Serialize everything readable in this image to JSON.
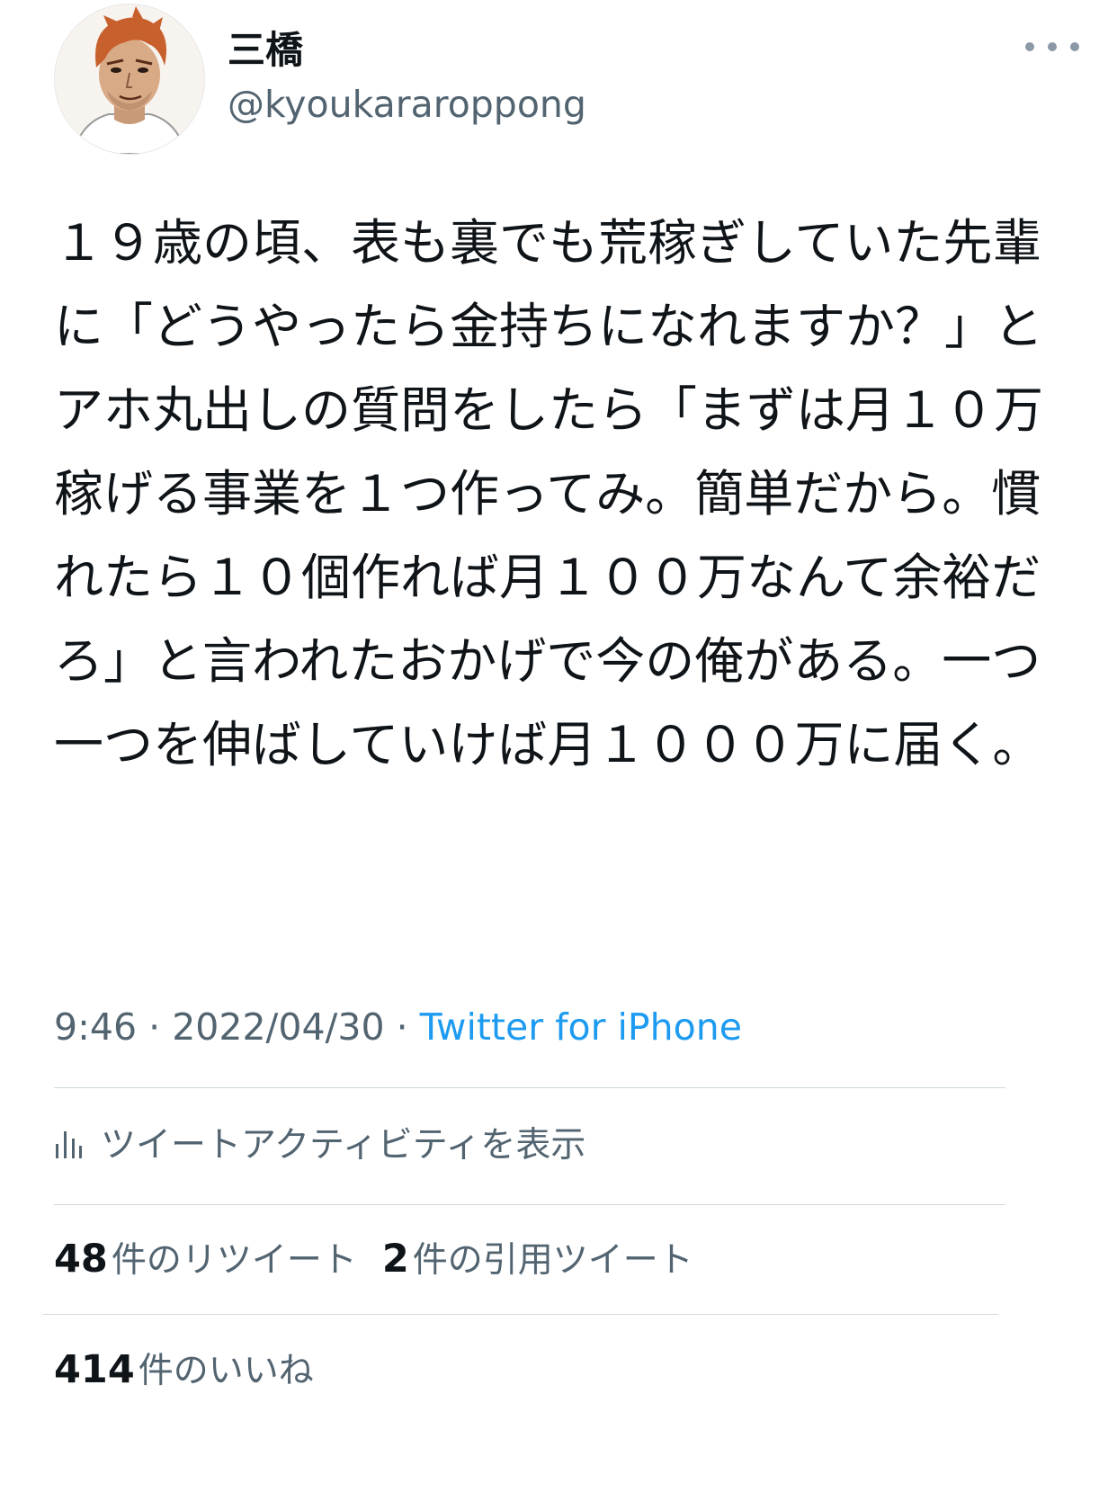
{
  "author": {
    "display_name": "三橋",
    "handle": "@kyoukararoppong",
    "avatar": "avatar-illustration"
  },
  "tweet": {
    "text": "１９歳の頃、表も裏でも荒稼ぎしていた先輩に「どうやったら金持ちになれますか？」とアホ丸出しの質問をしたら「まずは月１０万稼げる事業を１つ作ってみ。簡単だから。慣れたら１０個作れば月１００万なんて余裕だろ」と言われたおかげで今の俺がある。一つ一つを伸ばしていけば月１０００万に届く。"
  },
  "meta": {
    "time": "9:46",
    "separator": "·",
    "date": "2022/04/30",
    "source": "Twitter for iPhone"
  },
  "activity": {
    "label": "ツイートアクティビティを表示",
    "icon": "analytics-icon"
  },
  "stats": {
    "retweets_count": "48",
    "retweets_label": "件のリツイート",
    "quotes_count": "2",
    "quotes_label": "件の引用ツイート",
    "likes_count": "414",
    "likes_label": "件のいいね"
  },
  "colors": {
    "accent": "#1d9bf0",
    "secondary_text": "#536471",
    "primary_text": "#0f1419",
    "divider": "#cfd9de"
  }
}
